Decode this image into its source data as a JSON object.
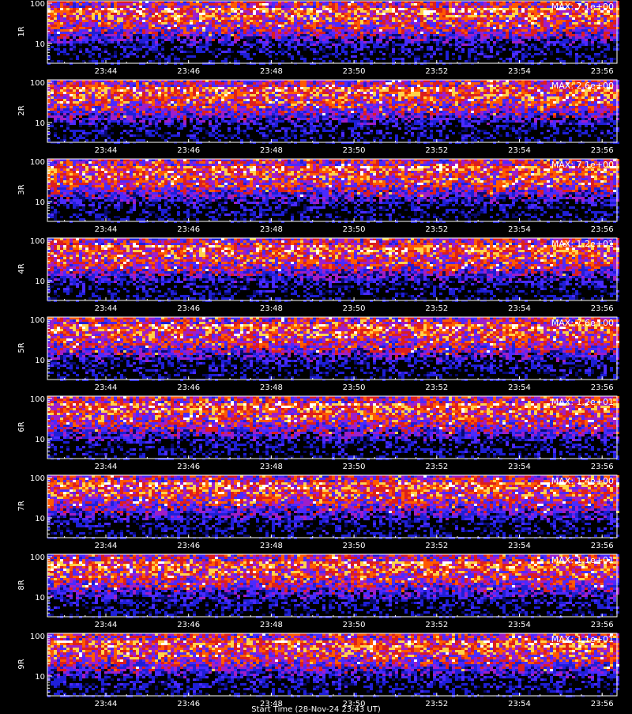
{
  "chart_data": {
    "type": "heatmap",
    "colors": {
      "background": "#000000",
      "axes": "#ffffff",
      "scale": [
        "#000000",
        "#0a0a6e",
        "#1f1fd6",
        "#4b2aff",
        "#a01ec8",
        "#dc1e1e",
        "#ff5a00",
        "#ffd24a",
        "#ffffff"
      ]
    },
    "x_tick_labels": [
      "23:44",
      "23:46",
      "23:48",
      "23:50",
      "23:52",
      "23:54",
      "23:56"
    ],
    "y_tick_labels": [
      "10",
      "100"
    ],
    "y_scale": "log",
    "xlabel": "Start Time (28-Nov-24 23:43 UT)",
    "panels": [
      {
        "label": "1R",
        "max": "MAX: 7.1e+00"
      },
      {
        "label": "2R",
        "max": "MAX: 2.6e+00"
      },
      {
        "label": "3R",
        "max": "MAX: 7.1e+00"
      },
      {
        "label": "4R",
        "max": "MAX: 1.2e+01"
      },
      {
        "label": "5R",
        "max": "MAX: 7.6e+00"
      },
      {
        "label": "6R",
        "max": "MAX: 1.2e+01"
      },
      {
        "label": "7R",
        "max": "MAX: 1.4e+00"
      },
      {
        "label": "8R",
        "max": "MAX: 1.1e+01"
      },
      {
        "label": "9R",
        "max": "MAX: 1.1e+01"
      }
    ]
  }
}
